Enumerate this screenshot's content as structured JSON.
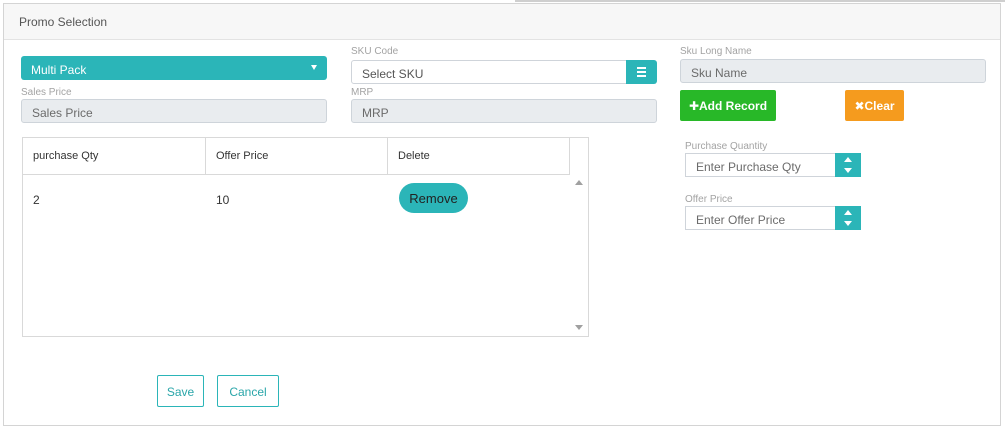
{
  "panel": {
    "title": "Promo Selection"
  },
  "promo_type": {
    "selected": "Multi Pack"
  },
  "sku_code": {
    "label": "SKU Code",
    "placeholder": "Select SKU"
  },
  "sku_long_name": {
    "label": "Sku Long Name",
    "placeholder": "Sku Name"
  },
  "sales_price": {
    "label": "Sales Price",
    "placeholder": "Sales Price"
  },
  "mrp": {
    "label": "MRP",
    "placeholder": "MRP"
  },
  "actions": {
    "add_label": "Add Record",
    "add_icon": "plus-icon",
    "clear_label": "Clear",
    "clear_icon": "x-icon"
  },
  "table": {
    "columns": [
      "purchase Qty",
      "Offer Price",
      "Delete"
    ],
    "rows": [
      {
        "purchase_qty": "2",
        "offer_price": "10",
        "action": "Remove"
      }
    ]
  },
  "purchase_quantity": {
    "label": "Purchase Quantity",
    "placeholder": "Enter Purchase Qty"
  },
  "offer_price": {
    "label": "Offer Price",
    "placeholder": "Enter Offer Price"
  },
  "footer": {
    "save_label": "Save",
    "cancel_label": "Cancel"
  },
  "colors": {
    "teal": "#2bb5b8",
    "green": "#28b828",
    "orange": "#f59b1e"
  }
}
